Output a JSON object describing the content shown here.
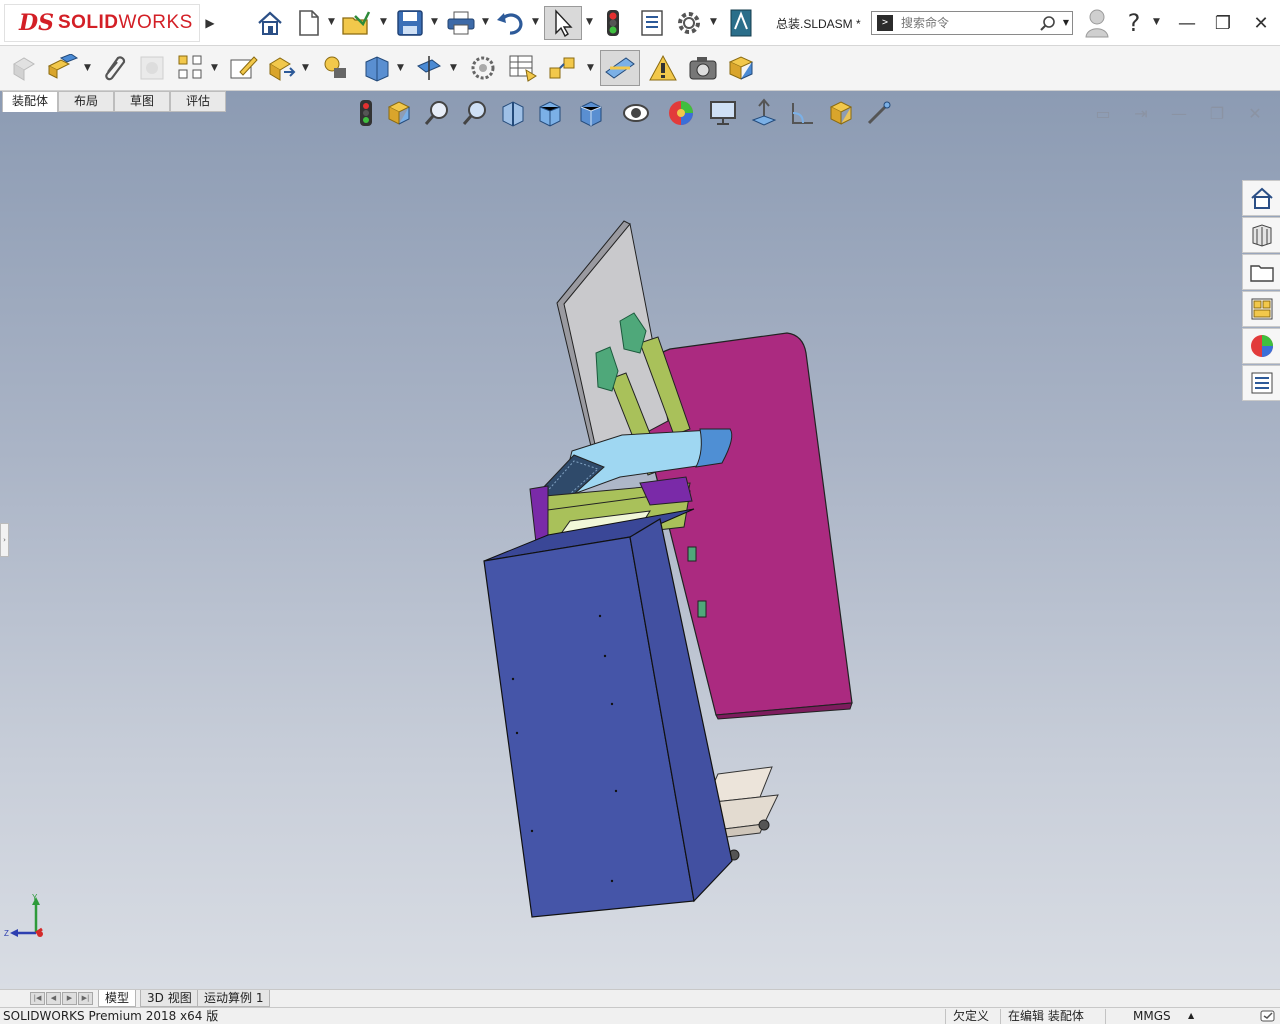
{
  "app": {
    "logo_ds": "DS",
    "logo_solid": "SOLID",
    "logo_works": "WORKS",
    "document_title": "总装.SLDASM *"
  },
  "search": {
    "placeholder": "搜索命令"
  },
  "window_controls": {
    "minimize": "—",
    "restore": "❐",
    "close": "✕"
  },
  "tabs": [
    {
      "label": "装配体",
      "active": true
    },
    {
      "label": "布局",
      "active": false
    },
    {
      "label": "草图",
      "active": false
    },
    {
      "label": "评估",
      "active": false
    }
  ],
  "viewport_controls": {
    "icon1": "▭",
    "icon2": "⇥",
    "minimize": "—",
    "restore": "❐",
    "close": "✕"
  },
  "triad": {
    "y": "Y",
    "z": "Z"
  },
  "bottom_tabs": [
    {
      "label": "模型",
      "active": true
    },
    {
      "label": "3D 视图",
      "active": false
    },
    {
      "label": "运动算例 1",
      "active": false
    }
  ],
  "nav_arrows": [
    "|◀",
    "◀",
    "▶",
    "▶|"
  ],
  "statusbar": {
    "version": "SOLIDWORKS Premium 2018 x64 版",
    "definition": "欠定义",
    "editing": "在编辑 装配体",
    "units": "MMGS",
    "units_arrow": "▲"
  },
  "colors": {
    "brand_red": "#d31f26",
    "part_blue": "#4555a8",
    "part_magenta": "#ab2a80",
    "part_green": "#a9c15a",
    "part_cyan": "#9fd7f2",
    "bracket_green": "#4fa87a",
    "monitor_gray": "#c9c9cc",
    "base_beige": "#ece4da"
  }
}
